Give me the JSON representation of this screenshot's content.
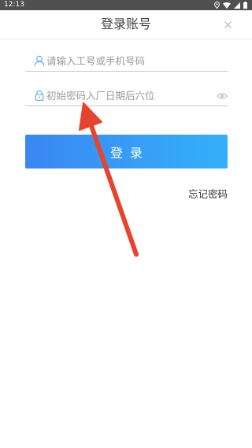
{
  "status_bar": {
    "time": "12:13",
    "icons": [
      "location-icon",
      "wifi-icon",
      "signal-icon",
      "battery-icon"
    ]
  },
  "header": {
    "title": "登录账号",
    "close_icon": "close-icon"
  },
  "form": {
    "account_placeholder": "请输入工号或手机号码",
    "account_value": "",
    "password_placeholder": "初始密码入厂日期后六位",
    "password_value": "",
    "account_icon": "user-icon",
    "password_icon": "lock-icon",
    "visibility_icon": "eye-icon"
  },
  "actions": {
    "login_label": "登录",
    "forgot_label": "忘记密码"
  },
  "colors": {
    "button_gradient_start": "#3b87f2",
    "button_gradient_end": "#33b0f9",
    "icon_blue": "#5aa5ee",
    "annotation_arrow": "#e8432f"
  }
}
